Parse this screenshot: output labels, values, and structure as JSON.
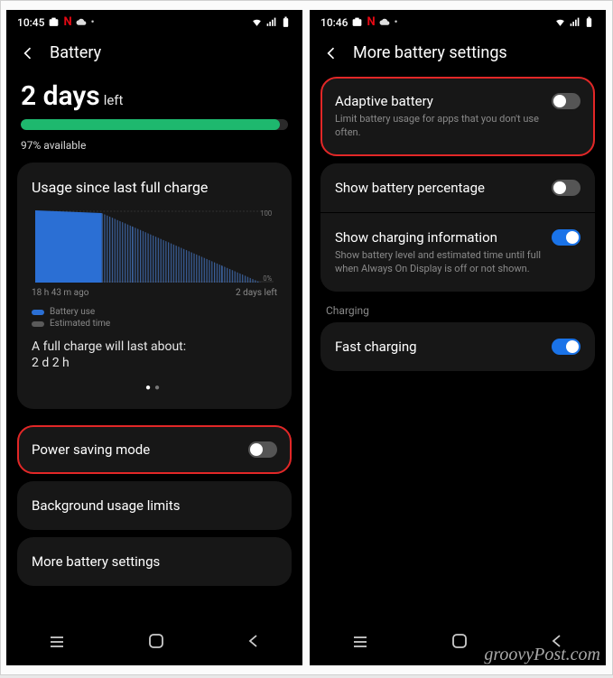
{
  "watermark": "groovyPost.com",
  "left": {
    "status_time": "10:45",
    "header_title": "Battery",
    "days_value": "2 days",
    "days_suffix": "left",
    "available": "97% available",
    "progress_percent": 97,
    "usage_title": "Usage since last full charge",
    "chart_x_left": "18 h 43 m ago",
    "chart_x_right": "2 days left",
    "legend_battery": "Battery use",
    "legend_estimated": "Estimated time",
    "estimate_label": "A full charge will last about:",
    "estimate_value": "2 d 2 h",
    "rows": {
      "power_saving": "Power saving mode",
      "background": "Background usage limits",
      "more": "More battery settings"
    }
  },
  "right": {
    "status_time": "10:46",
    "header_title": "More battery settings",
    "rows": {
      "adaptive_title": "Adaptive battery",
      "adaptive_sub": "Limit battery usage for apps that you don't use often.",
      "show_percent": "Show battery percentage",
      "show_info_title": "Show charging information",
      "show_info_sub": "Show battery level and estimated time until full when Always On Display is off or not shown.",
      "charging_section": "Charging",
      "fast_charging": "Fast charging"
    }
  },
  "chart_data": {
    "type": "area",
    "x_range": [
      "18 h 43 m ago",
      "now",
      "2 days left"
    ],
    "y_range": [
      0,
      100
    ],
    "y_ticks": [
      0,
      100
    ],
    "series": [
      {
        "name": "Battery use",
        "color": "#2b6fd4",
        "points": [
          {
            "x": 0.0,
            "y": 100
          },
          {
            "x": 0.28,
            "y": 97
          }
        ]
      },
      {
        "name": "Estimated time",
        "color": "#4a6a9a",
        "style": "hatched",
        "points": [
          {
            "x": 0.28,
            "y": 97
          },
          {
            "x": 1.0,
            "y": 0
          }
        ]
      }
    ]
  }
}
